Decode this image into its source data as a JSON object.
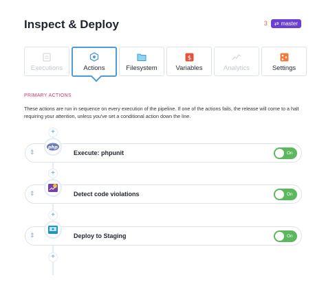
{
  "header": {
    "title": "Inspect & Deploy",
    "revision_indicator": "3",
    "branch": "master",
    "branch_icon": "branch-icon"
  },
  "tabs": [
    {
      "label": "Executions",
      "icon": "executions-icon",
      "state": "disabled"
    },
    {
      "label": "Actions",
      "icon": "actions-icon",
      "state": "active"
    },
    {
      "label": "Filesystem",
      "icon": "filesystem-icon",
      "state": "normal"
    },
    {
      "label": "Variables",
      "icon": "variables-icon",
      "state": "normal"
    },
    {
      "label": "Analytics",
      "icon": "analytics-icon",
      "state": "disabled"
    },
    {
      "label": "Settings",
      "icon": "settings-icon",
      "state": "normal"
    }
  ],
  "section": {
    "label": "PRIMARY ACTIONS",
    "description": "These actions are run in sequence on every execution of the pipeline. If one of the actions fails, the release will come to a halt requiring your attention, unless you've set a conditional action down the line."
  },
  "actions": [
    {
      "name": "Execute: phpunit",
      "icon": "php-icon",
      "toggle": "On",
      "enabled": true
    },
    {
      "name": "Detect code violations",
      "icon": "code-violations-icon",
      "toggle": "On",
      "enabled": true
    },
    {
      "name": "Deploy to Staging",
      "icon": "deploy-server-icon",
      "toggle": "On",
      "enabled": true
    }
  ],
  "colors": {
    "accent": "#4a9bd6",
    "branch_badge": "#6b3fd4",
    "section_label": "#d6336c",
    "toggle_on": "#5cb85c"
  }
}
